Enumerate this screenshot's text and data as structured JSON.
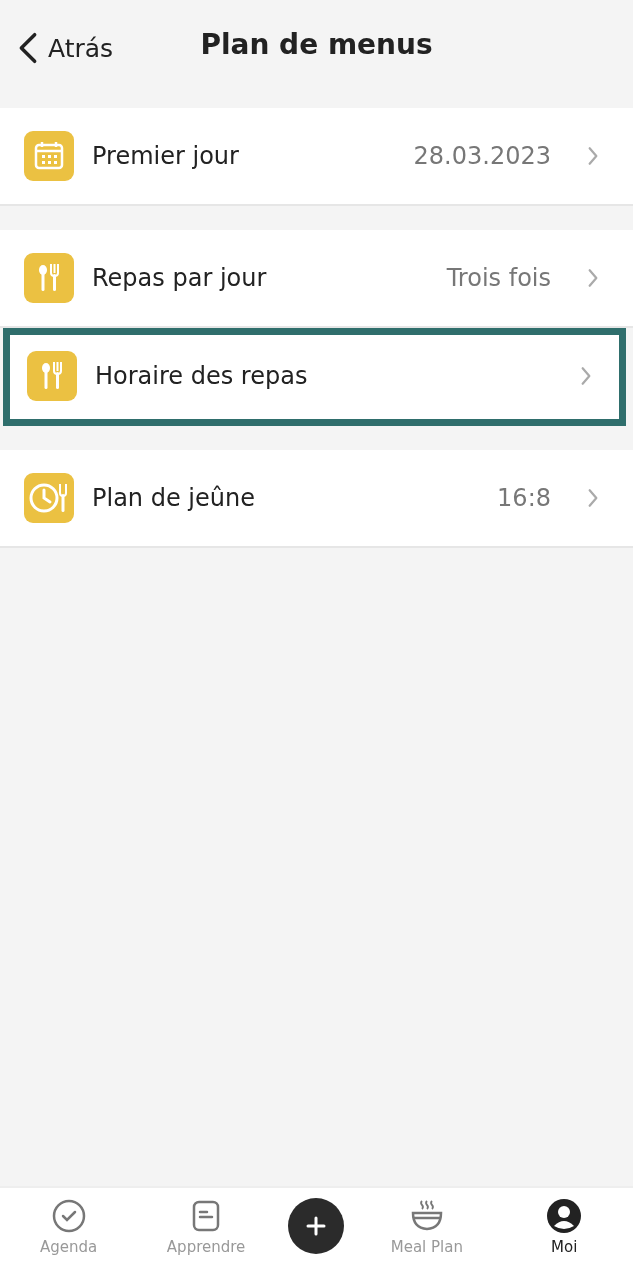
{
  "header": {
    "back": "Atrás",
    "title": "Plan de menus"
  },
  "groups": [
    {
      "items": [
        {
          "kind": "calendar",
          "label": "Premier jour",
          "value": "28.03.2023",
          "highlighted": false
        }
      ]
    },
    {
      "items": [
        {
          "kind": "cutlery",
          "label": "Repas par jour",
          "value": "Trois fois",
          "highlighted": false
        },
        {
          "kind": "cutlery",
          "label": "Horaire des repas",
          "highlighted": true
        }
      ]
    },
    {
      "items": [
        {
          "kind": "clock",
          "label": "Plan de jeûne",
          "value": "16:8",
          "highlighted": false
        }
      ]
    }
  ],
  "tabs": [
    {
      "kind": "agenda",
      "label": "Agenda",
      "selected": false
    },
    {
      "kind": "learn",
      "label": "Apprendre",
      "selected": false
    },
    {
      "kind": "add",
      "selected": false
    },
    {
      "kind": "meal",
      "label": "Meal Plan",
      "selected": false
    },
    {
      "kind": "profile",
      "label": "Moi",
      "selected": true
    }
  ]
}
